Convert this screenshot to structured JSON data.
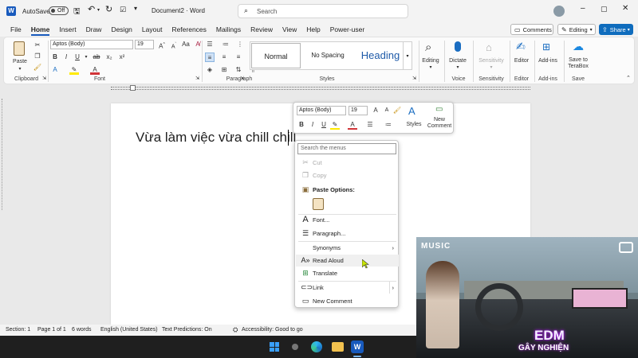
{
  "titlebar": {
    "autosave_label": "AutoSave",
    "autosave_state": "Off",
    "doc_title": "Document2 · Word",
    "search_placeholder": "Search"
  },
  "tabs": [
    "File",
    "Home",
    "Insert",
    "Draw",
    "Design",
    "Layout",
    "References",
    "Mailings",
    "Review",
    "View",
    "Help",
    "Power-user"
  ],
  "active_tab": "Home",
  "right_controls": {
    "comments": "Comments",
    "editing": "Editing",
    "share": "Share"
  },
  "ribbon": {
    "clipboard": {
      "paste": "Paste",
      "label": "Clipboard"
    },
    "font": {
      "name": "Aptos (Body)",
      "size": "19",
      "label": "Font"
    },
    "paragraph": {
      "label": "Paragraph"
    },
    "styles": {
      "items": [
        "Normal",
        "No Spacing",
        "Heading"
      ],
      "label": "Styles"
    },
    "editing": {
      "label": "Editing"
    },
    "voice": {
      "dictate": "Dictate",
      "label": "Voice"
    },
    "sensitivity": {
      "btn": "Sensitivity",
      "label": "Sensitivity"
    },
    "editor": {
      "btn": "Editor",
      "label": "Editor"
    },
    "addins": {
      "btn": "Add-ins",
      "label": "Add-ins"
    },
    "save": {
      "btn_line1": "Save to",
      "btn_line2": "TeraBox",
      "label": "Save"
    }
  },
  "document": {
    "text": "Vừa làm việc vừa chill chill"
  },
  "minitoolbar": {
    "font": "Aptos (Body)",
    "size": "19",
    "styles": "Styles",
    "new_comment_1": "New",
    "new_comment_2": "Comment"
  },
  "context_menu": {
    "search_placeholder": "Search the menus",
    "cut": "Cut",
    "copy": "Copy",
    "paste_options": "Paste Options:",
    "font": "Font...",
    "paragraph": "Paragraph...",
    "synonyms": "Synonyms",
    "read_aloud": "Read Aloud",
    "translate": "Translate",
    "link": "Link",
    "new_comment": "New Comment"
  },
  "status": {
    "section": "Section: 1",
    "page": "Page 1 of 1",
    "words": "6 words",
    "language": "English (United States)",
    "predictions": "Text Predictions: On",
    "accessibility": "Accessibility: Good to go"
  },
  "video": {
    "logo": "MUSIC",
    "title": "EDM",
    "subtitle": "GÂY NGHIỆN"
  },
  "colors": {
    "accent": "#185abd",
    "share": "#0f6cbd",
    "font_red": "#d13438",
    "highlight_yellow": "#ffea00"
  }
}
